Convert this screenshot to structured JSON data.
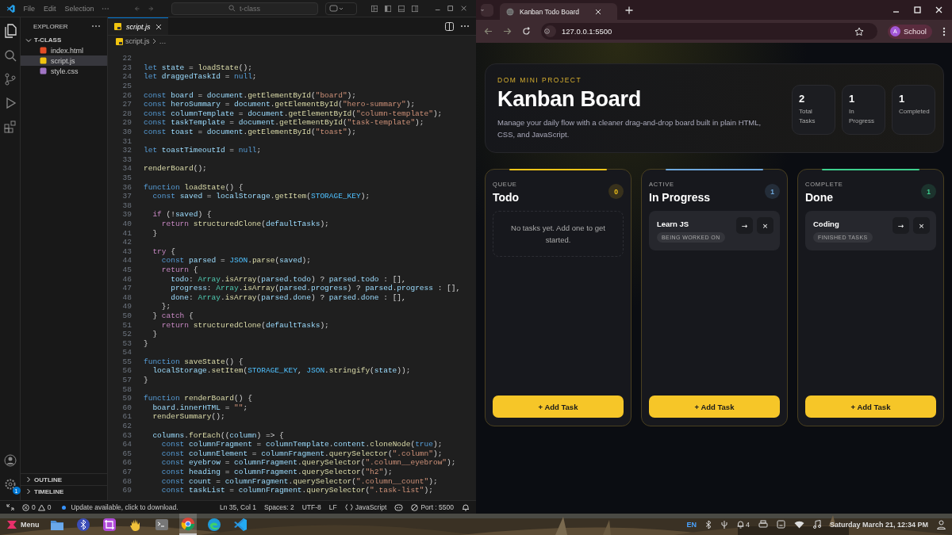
{
  "vscode": {
    "menu": [
      "File",
      "Edit",
      "Selection"
    ],
    "command_center": "t-class",
    "explorer": {
      "title": "EXPLORER",
      "folder": "T-CLASS",
      "expanded": true,
      "files": [
        {
          "name": "index.html",
          "kind": "html",
          "selected": false
        },
        {
          "name": "script.js",
          "kind": "js",
          "selected": true
        },
        {
          "name": "style.css",
          "kind": "css",
          "selected": false
        }
      ],
      "sections": [
        {
          "label": "OUTLINE",
          "expanded": false
        },
        {
          "label": "TIMELINE",
          "expanded": false
        }
      ]
    },
    "settings_badge": "1",
    "tabs": [
      {
        "label": "script.js",
        "selected": true
      }
    ],
    "breadcrumb": [
      "script.js",
      "…"
    ],
    "lines": [
      {
        "n": "22"
      },
      {
        "n": "23",
        "code": "let state = loadState();"
      },
      {
        "n": "24",
        "code": "let draggedTaskId = null;"
      },
      {
        "n": "25"
      },
      {
        "n": "26",
        "code": "const board = document.getElementById(\"board\");"
      },
      {
        "n": "27",
        "code": "const heroSummary = document.getElementById(\"hero-summary\");"
      },
      {
        "n": "28",
        "code": "const columnTemplate = document.getElementById(\"column-template\");"
      },
      {
        "n": "29",
        "code": "const taskTemplate = document.getElementById(\"task-template\");"
      },
      {
        "n": "30",
        "code": "const toast = document.getElementById(\"toast\");"
      },
      {
        "n": "31"
      },
      {
        "n": "32",
        "code": "let toastTimeoutId = null;"
      },
      {
        "n": "33"
      },
      {
        "n": "34",
        "code": "renderBoard();"
      },
      {
        "n": "35"
      },
      {
        "n": "36",
        "code": "function loadState() {"
      },
      {
        "n": "37",
        "code": "  const saved = localStorage.getItem(STORAGE_KEY);"
      },
      {
        "n": "38"
      },
      {
        "n": "39",
        "code": "  if (!saved) {"
      },
      {
        "n": "40",
        "code": "    return structuredClone(defaultTasks);"
      },
      {
        "n": "41",
        "code": "  }"
      },
      {
        "n": "42"
      },
      {
        "n": "43",
        "code": "  try {"
      },
      {
        "n": "44",
        "code": "    const parsed = JSON.parse(saved);"
      },
      {
        "n": "45",
        "code": "    return {"
      },
      {
        "n": "46",
        "code": "      todo: Array.isArray(parsed.todo) ? parsed.todo : [],"
      },
      {
        "n": "47",
        "code": "      progress: Array.isArray(parsed.progress) ? parsed.progress : [],"
      },
      {
        "n": "48",
        "code": "      done: Array.isArray(parsed.done) ? parsed.done : [],"
      },
      {
        "n": "49",
        "code": "    };"
      },
      {
        "n": "50",
        "code": "  } catch {"
      },
      {
        "n": "51",
        "code": "    return structuredClone(defaultTasks);"
      },
      {
        "n": "52",
        "code": "  }"
      },
      {
        "n": "53",
        "code": "}"
      },
      {
        "n": "54"
      },
      {
        "n": "55",
        "code": "function saveState() {"
      },
      {
        "n": "56",
        "code": "  localStorage.setItem(STORAGE_KEY, JSON.stringify(state));"
      },
      {
        "n": "57",
        "code": "}"
      },
      {
        "n": "58"
      },
      {
        "n": "59",
        "code": "function renderBoard() {"
      },
      {
        "n": "60",
        "code": "  board.innerHTML = \"\";"
      },
      {
        "n": "61",
        "code": "  renderSummary();"
      },
      {
        "n": "62"
      },
      {
        "n": "63",
        "code": "  columns.forEach((column) => {"
      },
      {
        "n": "64",
        "code": "    const columnFragment = columnTemplate.content.cloneNode(true);"
      },
      {
        "n": "65",
        "code": "    const columnElement = columnFragment.querySelector(\".column\");"
      },
      {
        "n": "66",
        "code": "    const eyebrow = columnFragment.querySelector(\".column__eyebrow\");"
      },
      {
        "n": "67",
        "code": "    const heading = columnFragment.querySelector(\"h2\");"
      },
      {
        "n": "68",
        "code": "    const count = columnFragment.querySelector(\".column__count\");"
      },
      {
        "n": "69",
        "code": "    const taskList = columnFragment.querySelector(\".task-list\");"
      }
    ],
    "status_bar": {
      "errors": "0",
      "warnings": "0",
      "message": "Update available, click to download.",
      "position": "Ln 35, Col 1",
      "indent": "Spaces: 2",
      "encoding": "UTF-8",
      "eol": "LF",
      "language": "JavaScript",
      "port": "Port : 5500"
    }
  },
  "browser": {
    "tab": {
      "title": "Kanban Todo Board"
    },
    "url": "127.0.0.1:5500",
    "profile": {
      "initial": "A",
      "name": "School"
    },
    "page": {
      "eyebrow": "DOM MINI PROJECT",
      "title": "Kanban Board",
      "description": "Manage your daily flow with a cleaner drag-and-drop board built in plain HTML, CSS, and JavaScript.",
      "stats": [
        {
          "value": "2",
          "label": "Total Tasks"
        },
        {
          "value": "1",
          "label": "In Progress"
        },
        {
          "value": "1",
          "label": "Completed"
        }
      ],
      "columns": [
        {
          "eyebrow": "QUEUE",
          "title": "Todo",
          "count": "0",
          "color": "#f5c518",
          "empty_text": "No tasks yet. Add one to get started.",
          "add_label": "+ Add Task"
        },
        {
          "eyebrow": "ACTIVE",
          "title": "In Progress",
          "count": "1",
          "color": "#6fa8dc",
          "tasks": [
            {
              "title": "Learn JS",
              "tag": "BEING WORKED ON",
              "move": "→",
              "delete": "×"
            }
          ],
          "add_label": "+ Add Task"
        },
        {
          "eyebrow": "COMPLETE",
          "title": "Done",
          "count": "1",
          "color": "#3ecf8e",
          "tasks": [
            {
              "title": "Coding",
              "tag": "FINISHED TASKS",
              "move": "→",
              "delete": "×"
            }
          ],
          "add_label": "+ Add Task"
        }
      ]
    }
  },
  "taskbar": {
    "menu_label": "Menu",
    "apps": [
      {
        "kind": "files",
        "selected": false
      },
      {
        "kind": "bluetooth",
        "selected": false
      },
      {
        "kind": "crop",
        "selected": false
      },
      {
        "kind": "hand",
        "selected": false
      },
      {
        "kind": "terminal",
        "selected": false
      },
      {
        "kind": "chrome",
        "selected": true
      },
      {
        "kind": "edge",
        "selected": false
      },
      {
        "kind": "vscode",
        "selected": false
      }
    ],
    "language": "EN",
    "notifications": "4",
    "clock": "Saturday March 21, 12:34 PM"
  }
}
